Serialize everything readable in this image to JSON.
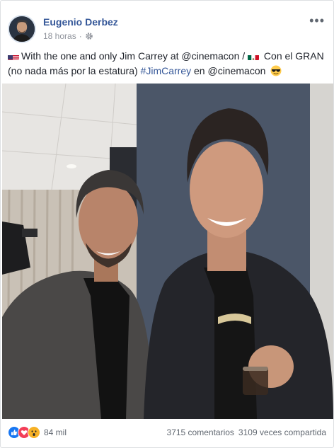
{
  "post": {
    "author": "Eugenio Derbez",
    "time": "18 horas",
    "separator": "·",
    "privacy_icon": "gear-icon",
    "more_label": "•••",
    "text": {
      "part1": "With the one and only Jim Carrey at @cinemacon / ",
      "part2": " Con el GRAN (no nada más por la estatura) ",
      "hashtag": "#JimCarrey",
      "part3": " en @cinemacon "
    },
    "reactions": {
      "icons": [
        "like-icon",
        "love-icon",
        "wow-icon"
      ],
      "count": "84 mil"
    },
    "comments": "3715 comentarios",
    "shares": "3109 veces compartida"
  },
  "colors": {
    "link": "#365899",
    "text": "#1d2129",
    "meta": "#90949c",
    "like": "#1877f2",
    "love": "#f33e58",
    "wow": "#f7b125"
  }
}
